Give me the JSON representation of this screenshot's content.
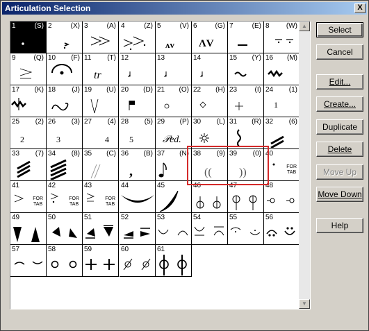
{
  "window": {
    "title": "Articulation Selection",
    "close_label": "X"
  },
  "buttons": {
    "select": "Select",
    "cancel": "Cancel",
    "edit": "Edit...",
    "create": "Create...",
    "duplicate": "Duplicate",
    "delete": "Delete",
    "move_up": "Move Up",
    "move_down": "Move Down",
    "help": "Help"
  },
  "scrollbar": {
    "up": "▲",
    "down": "▼"
  },
  "cells": [
    {
      "n": "1",
      "k": "(S)",
      "g": "dot",
      "selected": true
    },
    {
      "n": "2",
      "k": "(X)",
      "g": "accent-small"
    },
    {
      "n": "3",
      "k": "(A)",
      "g": "accent"
    },
    {
      "n": "4",
      "k": "(Z)",
      "g": "accent-dot"
    },
    {
      "n": "5",
      "k": "(V)",
      "g": "marcato-small"
    },
    {
      "n": "6",
      "k": "(G)",
      "g": "marcato"
    },
    {
      "n": "7",
      "k": "(E)",
      "g": "tenuto"
    },
    {
      "n": "8",
      "k": "(W)",
      "g": "tenuto-dot"
    },
    {
      "n": "9",
      "k": "(Q)",
      "g": "accent-lines"
    },
    {
      "n": "10",
      "k": "(F)",
      "g": "fermata"
    },
    {
      "n": "11",
      "k": "(T)",
      "g": "trill"
    },
    {
      "n": "12",
      "k": "",
      "g": "tiny-mark"
    },
    {
      "n": "13",
      "k": "",
      "g": "tiny-mark"
    },
    {
      "n": "14",
      "k": "",
      "g": "tiny-mark"
    },
    {
      "n": "15",
      "k": "(Y)",
      "g": "turn"
    },
    {
      "n": "16",
      "k": "(M)",
      "g": "mordent"
    },
    {
      "n": "17",
      "k": "(K)",
      "g": "inv-mordent"
    },
    {
      "n": "18",
      "k": "(J)",
      "g": "turn-big"
    },
    {
      "n": "19",
      "k": "(U)",
      "g": "wedge-thin"
    },
    {
      "n": "20",
      "k": "(D)",
      "g": "flag"
    },
    {
      "n": "21",
      "k": "(O)",
      "g": "circle-small"
    },
    {
      "n": "22",
      "k": "(H)",
      "g": "diamond"
    },
    {
      "n": "23",
      "k": "(I)",
      "g": "plus"
    },
    {
      "n": "24",
      "k": "(1)",
      "g": "finger-1"
    },
    {
      "n": "25",
      "k": "(2)",
      "g": "finger-2"
    },
    {
      "n": "26",
      "k": "(3)",
      "g": "finger-3"
    },
    {
      "n": "27",
      "k": "(4)",
      "g": "finger-4"
    },
    {
      "n": "28",
      "k": "(5)",
      "g": "finger-5"
    },
    {
      "n": "29",
      "k": "(P)",
      "g": "ped"
    },
    {
      "n": "30",
      "k": "(L)",
      "g": "ped-release"
    },
    {
      "n": "31",
      "k": "(R)",
      "g": "squiggle"
    },
    {
      "n": "32",
      "k": "(6)",
      "g": "tremolo-2"
    },
    {
      "n": "33",
      "k": "(7)",
      "g": "tremolo-3"
    },
    {
      "n": "34",
      "k": "(8)",
      "g": "tremolo-4"
    },
    {
      "n": "35",
      "k": "(C)",
      "g": "caesura"
    },
    {
      "n": "36",
      "k": "(B)",
      "g": "breath"
    },
    {
      "n": "37",
      "k": "(N)",
      "g": "eighth"
    },
    {
      "n": "38",
      "k": "(9)",
      "g": "paren-left"
    },
    {
      "n": "39",
      "k": "(0)",
      "g": "paren-right"
    },
    {
      "n": "40",
      "k": "",
      "g": "for-tab-dot",
      "t1": "FOR",
      "t2": "TAB"
    },
    {
      "n": "41",
      "k": "",
      "g": "for-tab-accent",
      "t1": "FOR",
      "t2": "TAB"
    },
    {
      "n": "42",
      "k": "",
      "g": "for-tab-accent2",
      "t1": "FOR",
      "t2": "TAB"
    },
    {
      "n": "43",
      "k": "",
      "g": "for-tab-ge",
      "t1": "FOR",
      "t2": "TAB"
    },
    {
      "n": "44",
      "k": "",
      "g": "slur-big"
    },
    {
      "n": "45",
      "k": "",
      "g": "slur-curve"
    },
    {
      "n": "46",
      "k": "",
      "g": "circles-stem"
    },
    {
      "n": "47",
      "k": "",
      "g": "circles-stem-up"
    },
    {
      "n": "48",
      "k": "",
      "g": "circles-side"
    },
    {
      "n": "49",
      "k": "",
      "g": "wedges-big"
    },
    {
      "n": "50",
      "k": "",
      "g": "wedges-med"
    },
    {
      "n": "51",
      "k": "",
      "g": "wedges-tenuto"
    },
    {
      "n": "52",
      "k": "",
      "g": "wedges-flat"
    },
    {
      "n": "53",
      "k": "",
      "g": "arcs"
    },
    {
      "n": "54",
      "k": "",
      "g": "arcs-line"
    },
    {
      "n": "55",
      "k": "",
      "g": "arcs-dot"
    },
    {
      "n": "56",
      "k": "",
      "g": "faces"
    },
    {
      "n": "57",
      "k": "",
      "g": "small-arcs"
    },
    {
      "n": "58",
      "k": "",
      "g": "open-circles"
    },
    {
      "n": "59",
      "k": "",
      "g": "pluses"
    },
    {
      "n": "60",
      "k": "",
      "g": "slashed-circles"
    },
    {
      "n": "61",
      "k": "",
      "g": "circle-crosses"
    }
  ]
}
